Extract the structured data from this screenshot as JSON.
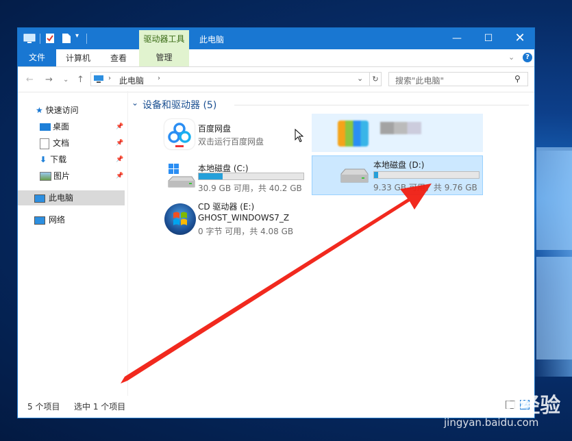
{
  "window": {
    "title": "此电脑",
    "tools_tab": "驱动器工具"
  },
  "ribbon": {
    "tabs": [
      "文件",
      "计算机",
      "查看",
      "管理"
    ]
  },
  "address": {
    "path": "此电脑",
    "search_placeholder": "搜索\"此电脑\""
  },
  "nav": {
    "quick_access": "快速访问",
    "items": [
      "桌面",
      "文档",
      "下载",
      "图片"
    ],
    "this_pc": "此电脑",
    "network": "网络"
  },
  "group": {
    "title": "设备和驱动器 (5)"
  },
  "devices": [
    {
      "name": "百度网盘",
      "sub": "双击运行百度网盘"
    },
    {
      "name": "本地磁盘 (C:)",
      "sub": "30.9 GB 可用，共 40.2 GB",
      "used_fraction": 0.23
    },
    {
      "name": "本地磁盘 (D:)",
      "sub": "9.33 GB 可用，共 9.76 GB",
      "used_fraction": 0.04
    },
    {
      "name": "CD 驱动器 (E:)",
      "label": "GHOST_WINDOWS7_Z",
      "sub": "0 字节 可用，共 4.08 GB"
    }
  ],
  "status": {
    "count": "5 个项目",
    "selected": "选中 1 个项目"
  },
  "watermark": {
    "brand": "Bai百du经验",
    "url": "jingyan.baidu.com"
  },
  "colors": {
    "accent": "#1977d2",
    "tools": "#e1f3cf",
    "selection": "#cce8ff",
    "bar": "#26a0da",
    "arrow": "#f01e12"
  }
}
